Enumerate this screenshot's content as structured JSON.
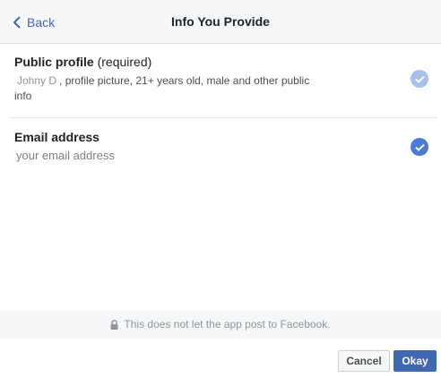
{
  "header": {
    "back_label": "Back",
    "title": "Info You Provide"
  },
  "permissions": [
    {
      "title": "Public profile",
      "qualifier": "(required)",
      "name": "Johny D",
      "details": ", profile picture, 21+ years old, male and other public info",
      "checked": true,
      "disabled": true,
      "check_color": "#a7c1ec"
    },
    {
      "title": "Email address",
      "value": "your email address",
      "checked": true,
      "disabled": false,
      "check_color": "#4b7bd9"
    }
  ],
  "notice": {
    "icon": "lock-icon",
    "text": "This does not let the app post to Facebook."
  },
  "actions": {
    "cancel_label": "Cancel",
    "okay_label": "Okay"
  },
  "colors": {
    "accent": "#4267b2",
    "header_bg": "#f6f7f9"
  }
}
